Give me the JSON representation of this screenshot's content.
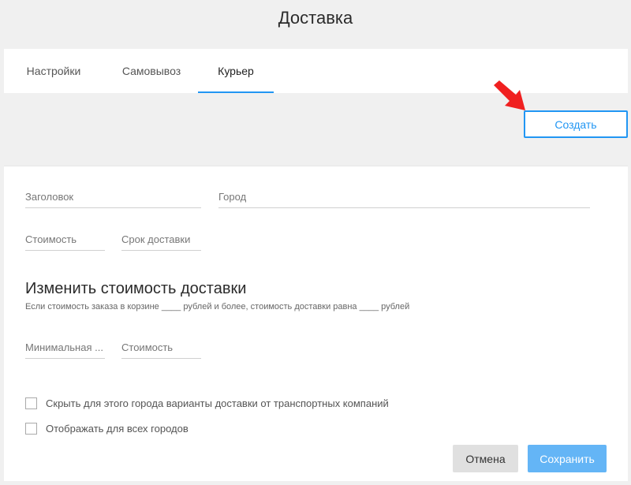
{
  "page_title": "Доставка",
  "tabs": [
    {
      "label": "Настройки",
      "active": false
    },
    {
      "label": "Самовывоз",
      "active": false
    },
    {
      "label": "Курьер",
      "active": true
    }
  ],
  "create_button": "Создать",
  "annotation_arrow": {
    "icon": "red-arrow-icon",
    "color": "#f02020"
  },
  "form": {
    "title_placeholder": "Заголовок",
    "city_placeholder": "Город",
    "cost_placeholder": "Стоимость",
    "delivery_time_placeholder": "Срок доставки",
    "section_title": "Изменить стоимость доставки",
    "section_subtitle": "Если стоимость заказа в корзине ____ рублей и более, стоимость доставки равна ____ рублей",
    "min_placeholder": "Минимальная ...",
    "cost2_placeholder": "Стоимость",
    "checkboxes": [
      {
        "label": "Скрыть для этого города варианты доставки от транспортных компаний",
        "checked": false
      },
      {
        "label": "Отображать для всех городов",
        "checked": false
      }
    ]
  },
  "buttons": {
    "cancel": "Отмена",
    "save": "Сохранить"
  },
  "colors": {
    "accent": "#2196f3",
    "save_bg": "#64b5f6",
    "background": "#f0f0f0"
  }
}
